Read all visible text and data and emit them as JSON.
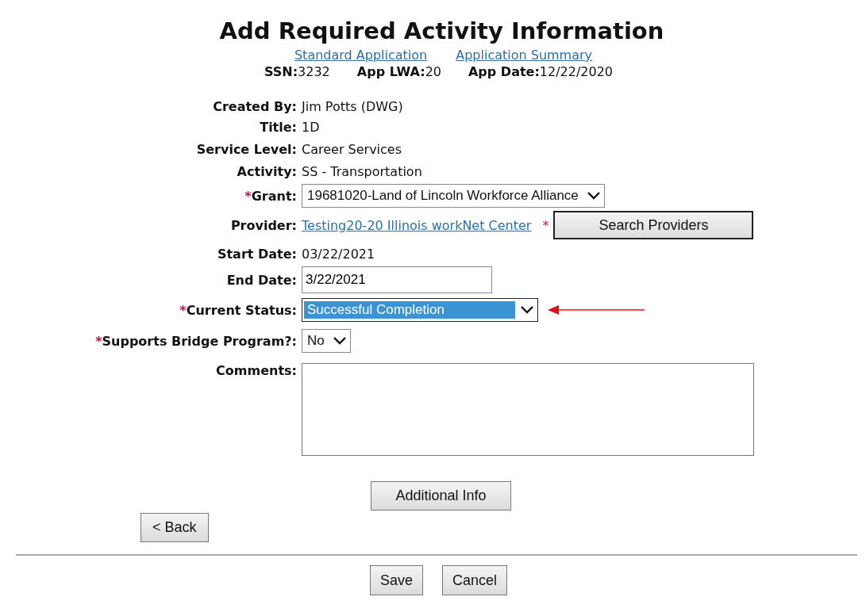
{
  "title": "Add Required Activity Information",
  "links": [
    "Standard Application",
    "Application Summary"
  ],
  "summary": [
    {
      "label": "SSN:",
      "value": "3232"
    },
    {
      "label": "App LWA:",
      "value": "20"
    },
    {
      "label": "App Date:",
      "value": "12/22/2020"
    }
  ],
  "fields": [
    {
      "kind": "text",
      "label": "Created By:",
      "value": "Jim Potts (DWG)"
    },
    {
      "kind": "text",
      "label": "Title:",
      "value": "1D"
    },
    {
      "kind": "text",
      "label": "Service Level:",
      "value": "Career Services"
    },
    {
      "kind": "text",
      "label": "Activity:",
      "value": "SS - Transportation"
    },
    {
      "kind": "select",
      "label": "Grant:",
      "required_mark": "*",
      "value": "19681020-Land of Lincoln Workforce Alliance",
      "highlighted": false
    },
    {
      "kind": "link",
      "label": "Provider:",
      "value": "Testing20-20 Illinois workNet Center",
      "button_mark": "*",
      "button": "Search Providers"
    },
    {
      "kind": "text",
      "label": "Start Date:",
      "value": "03/22/2021"
    },
    {
      "kind": "input",
      "label": "End Date:",
      "value": "3/22/2021"
    },
    {
      "kind": "select",
      "label": "Current Status:",
      "required_mark": "*",
      "value": "Successful Completion",
      "highlighted": true,
      "pointed": true
    },
    {
      "kind": "select",
      "label": "Supports Bridge Program?:",
      "required_mark": "*",
      "value": "No",
      "highlighted": false
    },
    {
      "kind": "textarea",
      "label": "Comments:"
    }
  ],
  "additional_button": "Additional Info",
  "back_button": "< Back",
  "footer_buttons": [
    "Save",
    "Cancel"
  ]
}
